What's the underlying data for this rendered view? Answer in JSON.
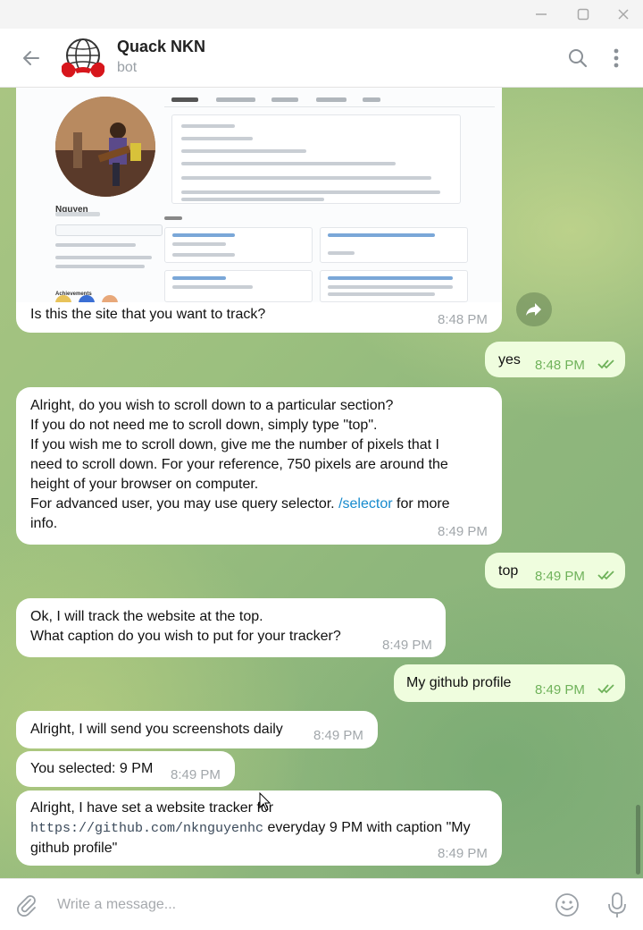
{
  "window": {
    "controls": {
      "minimize_icon": "minimize-icon",
      "maximize_icon": "maximize-icon",
      "close_icon": "close-icon"
    }
  },
  "header": {
    "title": "Quack NKN",
    "subtitle": "bot",
    "back_icon": "back-arrow-icon",
    "search_icon": "search-icon",
    "more_icon": "more-vertical-icon"
  },
  "preview": {
    "name": "Nguyen",
    "achievements": "Achievements",
    "tabs": [
      "Overview",
      "Repositories",
      "Projects",
      "Packages",
      "Stars"
    ],
    "pinned": "Pinned"
  },
  "messages": [
    {
      "id": "m1",
      "direction": "in",
      "text": "Is this the site that you want to track?",
      "time": "8:48 PM",
      "has_image": true
    },
    {
      "id": "m2",
      "direction": "out",
      "text": "yes",
      "time": "8:48 PM",
      "status": "read"
    },
    {
      "id": "m3",
      "direction": "in",
      "text_before": "Alright, do you wish to scroll down to a particular section?\nIf you do not need me to scroll down, simply type \"top\".\nIf you wish me to scroll down, give me the number of pixels that I\nneed to scroll down. For your reference, 750 pixels are around the\nheight of your browser on computer.\nFor advanced user, you may use query selector. ",
      "link": "/selector",
      "text_after": " for more\ninfo.",
      "time": "8:49 PM"
    },
    {
      "id": "m4",
      "direction": "out",
      "text": "top",
      "time": "8:49 PM",
      "status": "read"
    },
    {
      "id": "m5",
      "direction": "in",
      "text": "Ok, I will track the website at the top.\nWhat caption do you wish to put for your tracker?",
      "time": "8:49 PM"
    },
    {
      "id": "m6",
      "direction": "out",
      "text": "My github profile",
      "time": "8:49 PM",
      "status": "read"
    },
    {
      "id": "m7",
      "direction": "in",
      "text": "Alright, I will send you screenshots daily",
      "time": "8:49 PM"
    },
    {
      "id": "m8",
      "direction": "in",
      "text": "You selected: 9 PM",
      "time": "8:49 PM"
    },
    {
      "id": "m9",
      "direction": "in",
      "text_before": "Alright, I have set a website tracker for\n",
      "code": "https://github.com/nknguyenhc",
      "text_after": " everyday 9 PM with caption \"My\ngithub profile\"",
      "time": "8:49 PM"
    }
  ],
  "composer": {
    "placeholder": "Write a message...",
    "attach_icon": "paperclip-icon",
    "emoji_icon": "emoji-icon",
    "mic_icon": "microphone-icon"
  },
  "colors": {
    "incoming_bubble": "#ffffff",
    "outgoing_bubble": "#effdde",
    "time_outgoing": "#6fb25a",
    "link": "#168acd"
  }
}
